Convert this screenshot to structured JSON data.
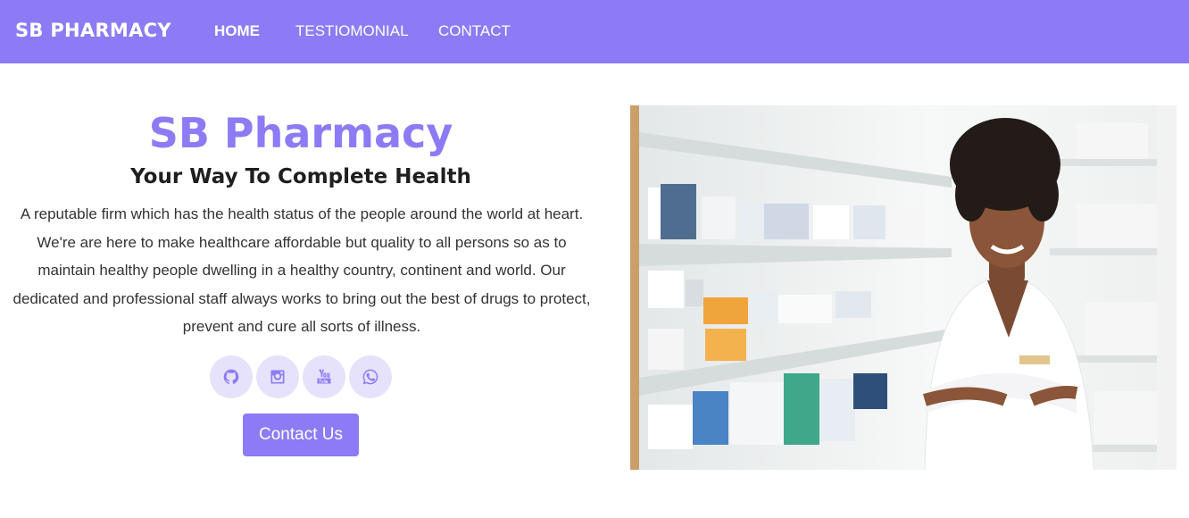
{
  "navbar": {
    "brand": "SB PHARMACY",
    "links": [
      {
        "label": "HOME",
        "active": true
      },
      {
        "label": "TESTIOMONIAL",
        "active": false
      },
      {
        "label": "CONTACT",
        "active": false
      }
    ]
  },
  "hero": {
    "title": "SB Pharmacy",
    "subtitle": "Your Way To Complete Health",
    "description": "A reputable firm which has the health status of the people around the world at heart. We're are here to make healthcare affordable but quality to all persons so as to maintain healthy people dwelling in a healthy country, continent and world. Our dedicated and professional staff always works to bring out the best of drugs to protect, prevent and cure all sorts of illness.",
    "socials": [
      {
        "icon": "github-icon"
      },
      {
        "icon": "instagram-icon"
      },
      {
        "icon": "youtube-icon"
      },
      {
        "icon": "whatsapp-icon"
      }
    ],
    "cta_label": "Contact Us",
    "image_label": "pharmacist"
  },
  "colors": {
    "accent": "#8c7bf4",
    "social_bg": "#e6e2fb"
  }
}
